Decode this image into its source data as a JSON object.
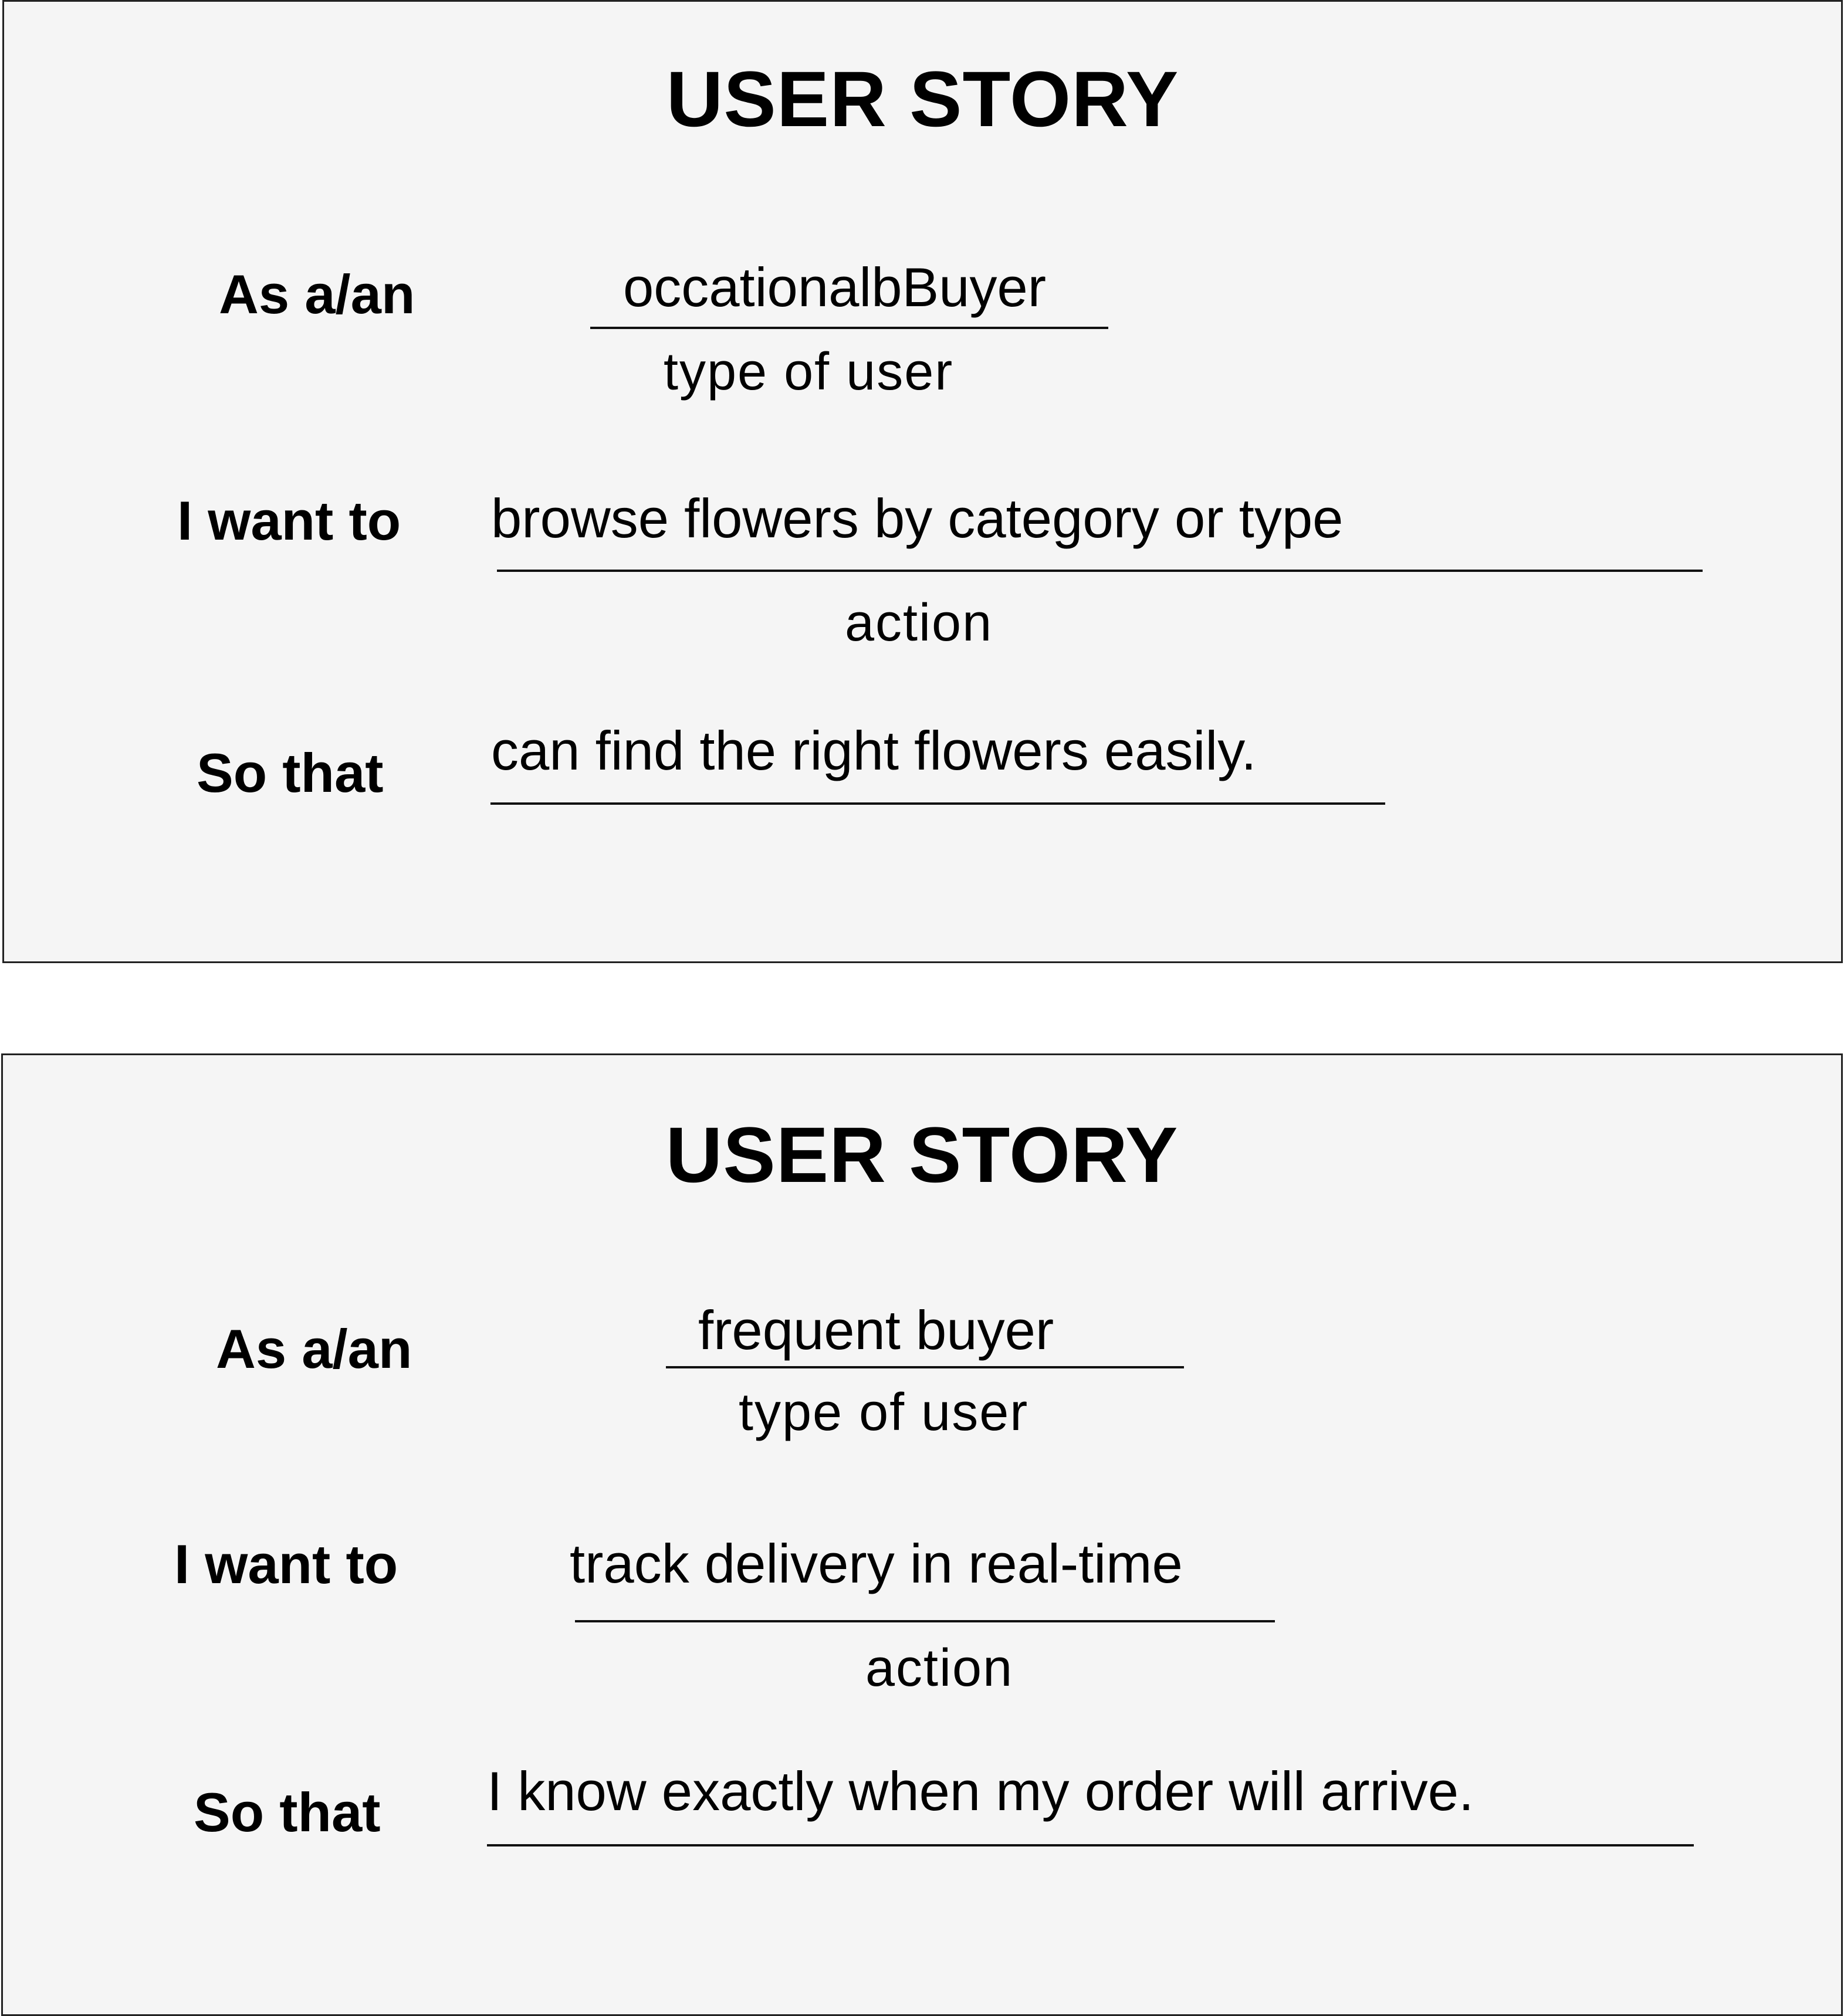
{
  "cards": [
    {
      "title": "USER STORY",
      "as_label": "As a/an",
      "as_value": "occationalbBuyer",
      "as_hint": "type of user",
      "want_label": "I want to",
      "want_value": "browse flowers by  category or type",
      "want_hint": "action",
      "so_label": "So that",
      "so_value": "can find the right flowers easily."
    },
    {
      "title": "USER STORY",
      "as_label": "As a/an",
      "as_value": "frequent buyer",
      "as_hint": "type of user",
      "want_label": "I want to",
      "want_value": "track delivery in real-time",
      "want_hint": "action",
      "so_label": "So that",
      "so_value": "I know exactly when my order will arrive."
    }
  ]
}
